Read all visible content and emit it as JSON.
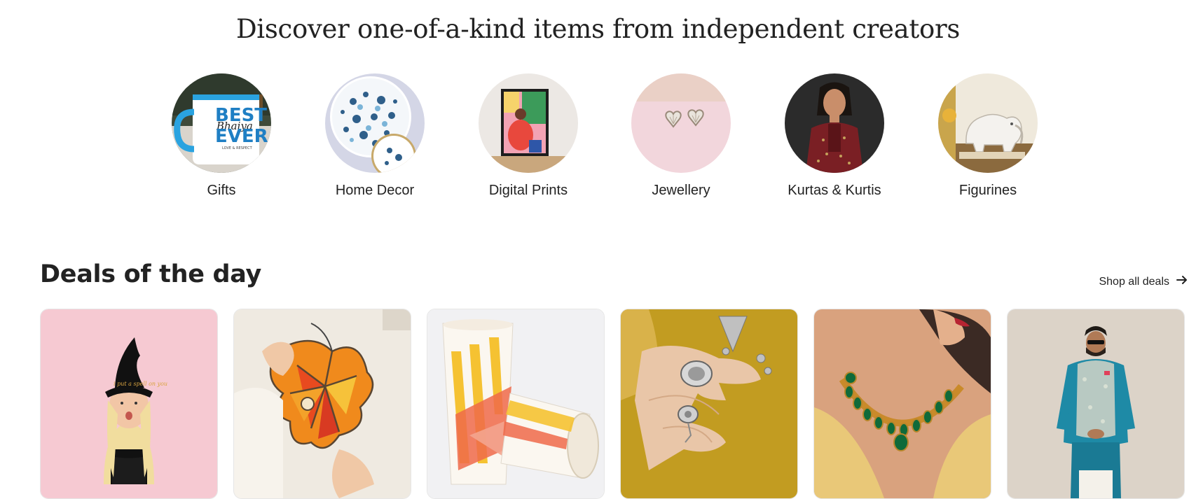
{
  "hero": {
    "title": "Discover one-of-a-kind items from independent creators"
  },
  "categories": [
    {
      "label": "Gifts",
      "image": "mug-photo"
    },
    {
      "label": "Home Decor",
      "image": "blue-floral-plate-photo"
    },
    {
      "label": "Digital Prints",
      "image": "framed-art-print-photo"
    },
    {
      "label": "Jewellery",
      "image": "heart-earrings-photo"
    },
    {
      "label": "Kurtas & Kurtis",
      "image": "woman-kurta-photo"
    },
    {
      "label": "Figurines",
      "image": "elephant-figurine-photo"
    }
  ],
  "mug": {
    "line1": "BEST",
    "line2": "EVER",
    "script": "Bhaiya",
    "small": "LOVE & RESPECT"
  },
  "deals": {
    "title": "Deals of the day",
    "shop_all_label": "Shop all deals",
    "shop_all_icon": "arrow-right-icon",
    "items": [
      {
        "image": "child-witch-hat-photo",
        "hat_text": "i put a spell on you"
      },
      {
        "image": "stained-glass-leaf-photo"
      },
      {
        "image": "ceramic-cups-photo"
      },
      {
        "image": "silver-ring-hand-photo"
      },
      {
        "image": "green-necklace-photo"
      },
      {
        "image": "man-nehru-jacket-photo"
      }
    ]
  },
  "colors": {
    "text": "#222222",
    "background": "#ffffff"
  }
}
